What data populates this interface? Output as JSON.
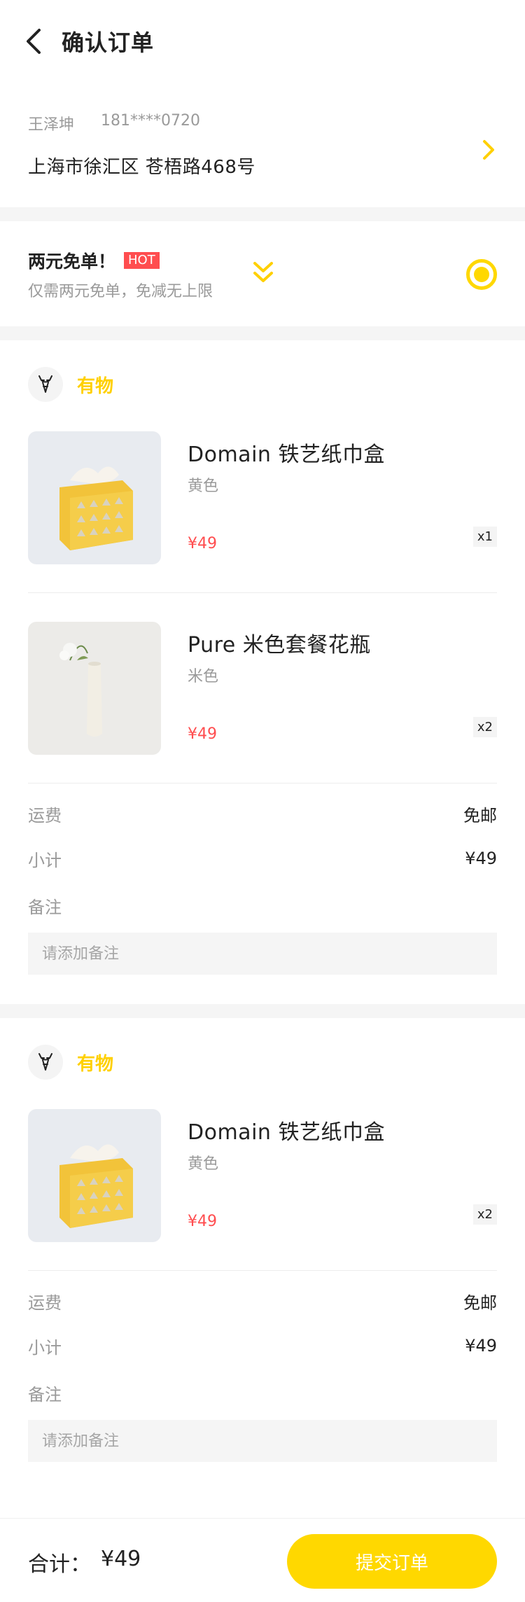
{
  "header": {
    "title": "确认订单",
    "back_icon": "chevron-left-icon"
  },
  "address": {
    "name": "王泽坤",
    "phone": "181****0720",
    "detail": "上海市徐汇区 苍梧路468号",
    "arrow_icon": "chevron-right-icon"
  },
  "promo": {
    "title": "两元免单！",
    "badge": "HOT",
    "subtitle": "仅需两元免单，免减无上限",
    "expand_icon": "double-chevron-down-icon",
    "selected": true
  },
  "orders": [
    {
      "store": {
        "name": "有物",
        "logo_icon": "deer-icon"
      },
      "items": [
        {
          "title": "Domain 铁艺纸巾盒",
          "variant": "黄色",
          "price": "¥49",
          "qty": "x1",
          "image": "tissue-box"
        },
        {
          "title": "Pure 米色套餐花瓶",
          "variant": "米色",
          "price": "¥49",
          "qty": "x2",
          "image": "vase"
        }
      ],
      "shipping_label": "运费",
      "shipping_value": "免邮",
      "subtotal_label": "小计",
      "subtotal_value": "¥49",
      "remark_label": "备注",
      "remark_placeholder": "请添加备注"
    },
    {
      "store": {
        "name": "有物",
        "logo_icon": "deer-icon"
      },
      "items": [
        {
          "title": "Domain 铁艺纸巾盒",
          "variant": "黄色",
          "price": "¥49",
          "qty": "x2",
          "image": "tissue-box"
        }
      ],
      "shipping_label": "运费",
      "shipping_value": "免邮",
      "subtotal_label": "小计",
      "subtotal_value": "¥49",
      "remark_label": "备注",
      "remark_placeholder": "请添加备注"
    }
  ],
  "footer": {
    "total_label": "合计：",
    "total_value": "¥49",
    "submit_label": "提交订单"
  },
  "colors": {
    "accent": "#ffd800",
    "price": "#ff4d4f",
    "muted": "#9a9a9a",
    "gap": "#f5f5f5"
  }
}
